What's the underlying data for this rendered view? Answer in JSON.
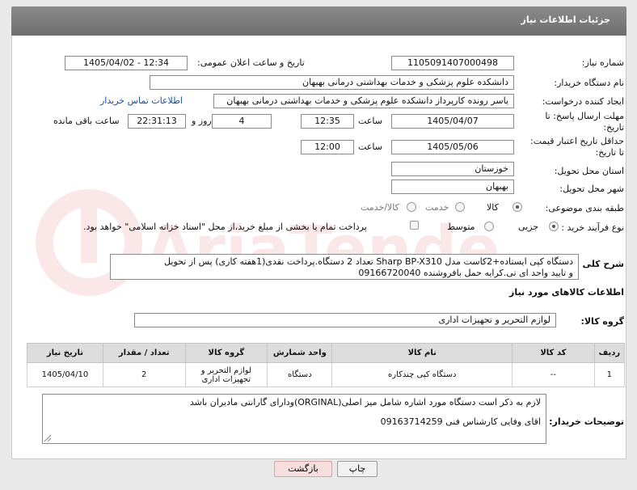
{
  "header": {
    "title": "جزئیات اطلاعات نیاز"
  },
  "form": {
    "need_number": {
      "label": "شماره نیاز:",
      "value": "1105091407000498"
    },
    "announce_datetime": {
      "label": "تاریخ و ساعت اعلان عمومی:",
      "value": "1405/04/02 - 12:34"
    },
    "buyer_org": {
      "label": "نام دستگاه خریدار:",
      "value": "دانشکده علوم پزشکی و خدمات بهداشتی  درمانی بهبهان"
    },
    "requester": {
      "label": "ایجاد کننده درخواست:",
      "value": "یاسر رونده کارپرداز دانشکده علوم پزشکی و خدمات بهداشتی  درمانی بهبهان",
      "contact_link": "اطلاعات تماس خریدار"
    },
    "reply_deadline": {
      "label_line1": "مهلت ارسال پاسخ: تا",
      "label_line2": "تاریخ:",
      "date": "1405/04/07",
      "time_label": "ساعت",
      "time": "12:35",
      "days": "4",
      "days_label": "روز و",
      "remaining": "22:31:13",
      "remaining_label": "ساعت باقی مانده"
    },
    "price_validity": {
      "label_line1": "حداقل تاریخ اعتبار قیمت:",
      "label_line2": "تا تاریخ:",
      "date": "1405/05/06",
      "time_label": "ساعت",
      "time": "12:00"
    },
    "delivery_province": {
      "label": "استان محل تحویل:",
      "value": "خوزستان"
    },
    "delivery_city": {
      "label": "شهر محل تحویل:",
      "value": "بهبهان"
    },
    "category": {
      "label": "طبقه بندی موضوعی:",
      "options": [
        "کالا",
        "خدمت",
        "کالا/خدمت"
      ],
      "selected": "کالا"
    },
    "process_type": {
      "label": "نوع فرآیند خرید :",
      "options": [
        "جزیی",
        "متوسط"
      ],
      "selected": "جزیی",
      "payment_note": "پرداخت تمام یا بخشی از مبلغ خرید،از محل \"اسناد خزانه اسلامی\" خواهد بود."
    },
    "general_desc": {
      "label": "شرح کلی نیاز:",
      "line1": "دستگاه کپی ایستاده+2کاست مدل Sharp BP-X310 تعداد 2 دستگاه.پرداخت نقدی(1هفته کاری) پس از تحویل",
      "line2": "و تایید واحد ای تی.کرایه حمل بافروشنده 09166720040"
    }
  },
  "goods_section": {
    "title": "اطلاعات کالاهای مورد نیاز",
    "group_label": "گروه کالا:",
    "group_value": "لوازم التحریر و تجهیزات اداری"
  },
  "table": {
    "headers": [
      "ردیف",
      "کد کالا",
      "نام کالا",
      "واحد شمارش",
      "گروه کالا",
      "تعداد / مقدار",
      "تاریخ نیاز"
    ],
    "rows": [
      {
        "row": "1",
        "code": "--",
        "name": "دستگاه کپی چندکاره",
        "unit": "دستگاه",
        "group_line1": "لوازم التحریر و",
        "group_line2": "تجهیزات اداری",
        "qty": "2",
        "date": "1405/04/10"
      }
    ]
  },
  "buyer_notes": {
    "label": "توضیحات خریدار:",
    "line1": "لازم به ذکر است دستگاه مورد اشاره شامل میز اصلی(ORGINAL)ودارای گارانتی مادیران باشد",
    "line2": "اقای وفایی کارشناس فنی 09163714259"
  },
  "buttons": {
    "print": "چاپ",
    "back": "بازگشت"
  },
  "watermark": {
    "text": "AriaTender.net"
  }
}
